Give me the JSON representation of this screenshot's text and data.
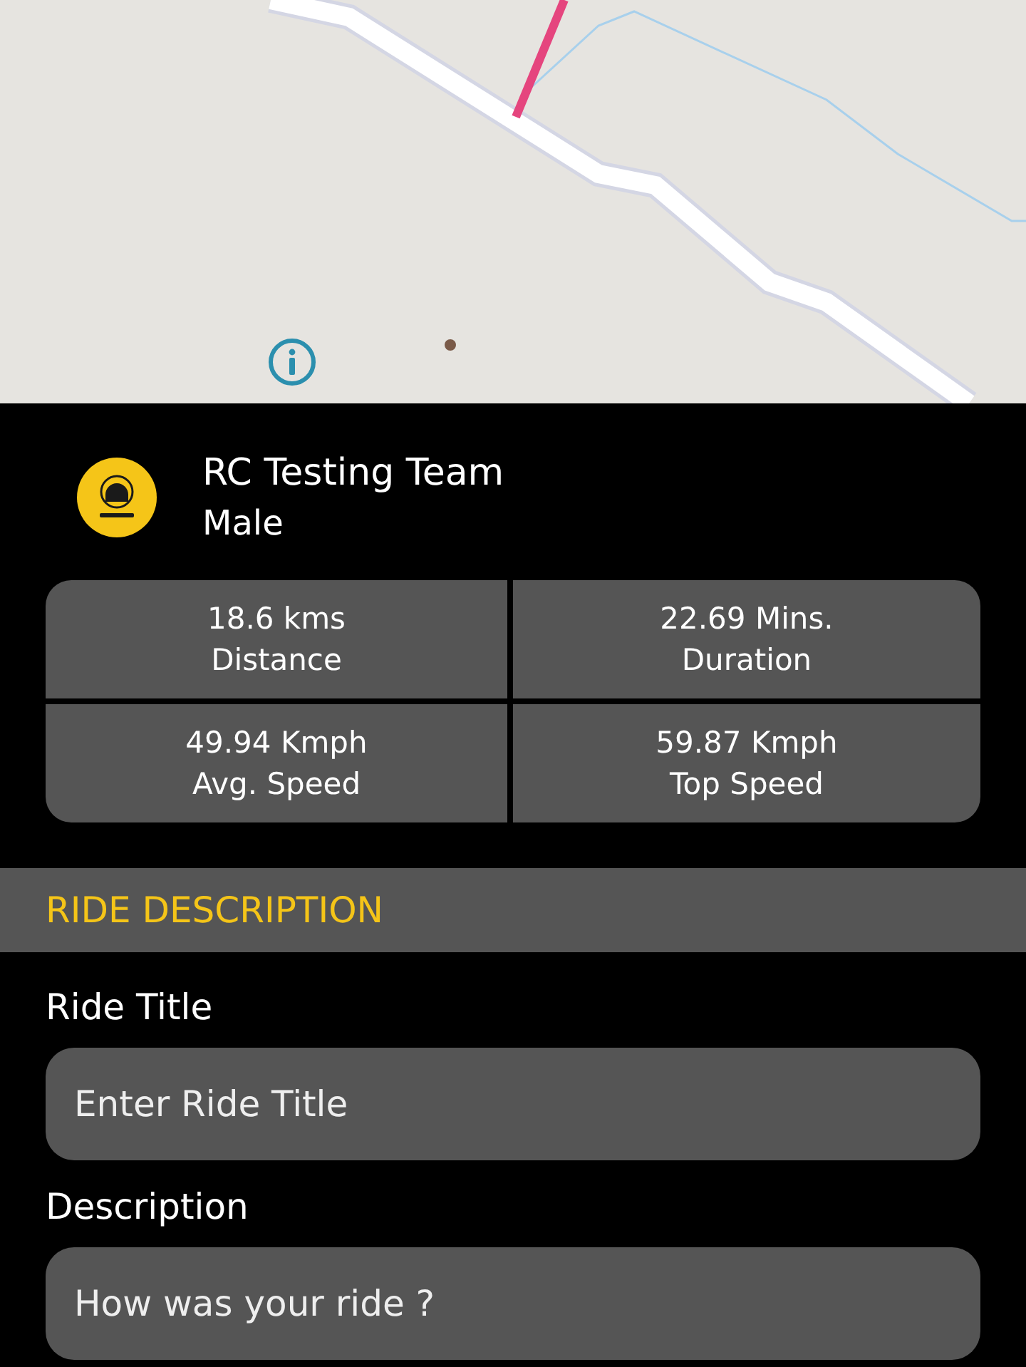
{
  "profile": {
    "name": "RC Testing Team",
    "gender": "Male"
  },
  "stats": [
    {
      "value": "18.6 kms",
      "label": "Distance"
    },
    {
      "value": "22.69 Mins.",
      "label": "Duration"
    },
    {
      "value": "49.94 Kmph",
      "label": "Avg. Speed"
    },
    {
      "value": "59.87 Kmph",
      "label": "Top Speed"
    }
  ],
  "section_title": "RIDE DESCRIPTION",
  "fields": [
    {
      "label": "Ride Title",
      "placeholder": "Enter Ride Title"
    },
    {
      "label": "Description",
      "placeholder": "How was your ride ?"
    }
  ]
}
